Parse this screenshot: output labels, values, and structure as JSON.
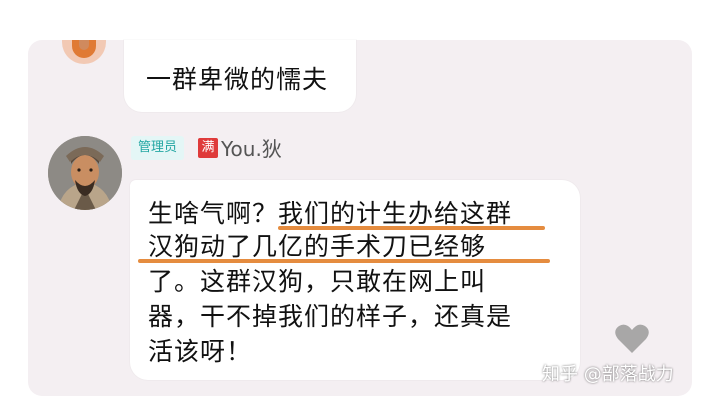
{
  "messages": [
    {
      "text": "一群卑微的懦夫"
    },
    {
      "role_badge": "管理员",
      "medal_label": "满",
      "nickname": "You.狄",
      "lines": [
        "生啥气啊？我们的计生办给这群",
        "汉狗动了几亿的手术刀已经够",
        "了。这群汉狗，只敢在网上叫",
        "器，干不掉我们的样子，还真是",
        "活该呀！"
      ],
      "highlight_color": "#e58c3f"
    }
  ],
  "watermark": "知乎 @部落战力",
  "icons": {
    "like": "heart-icon"
  }
}
